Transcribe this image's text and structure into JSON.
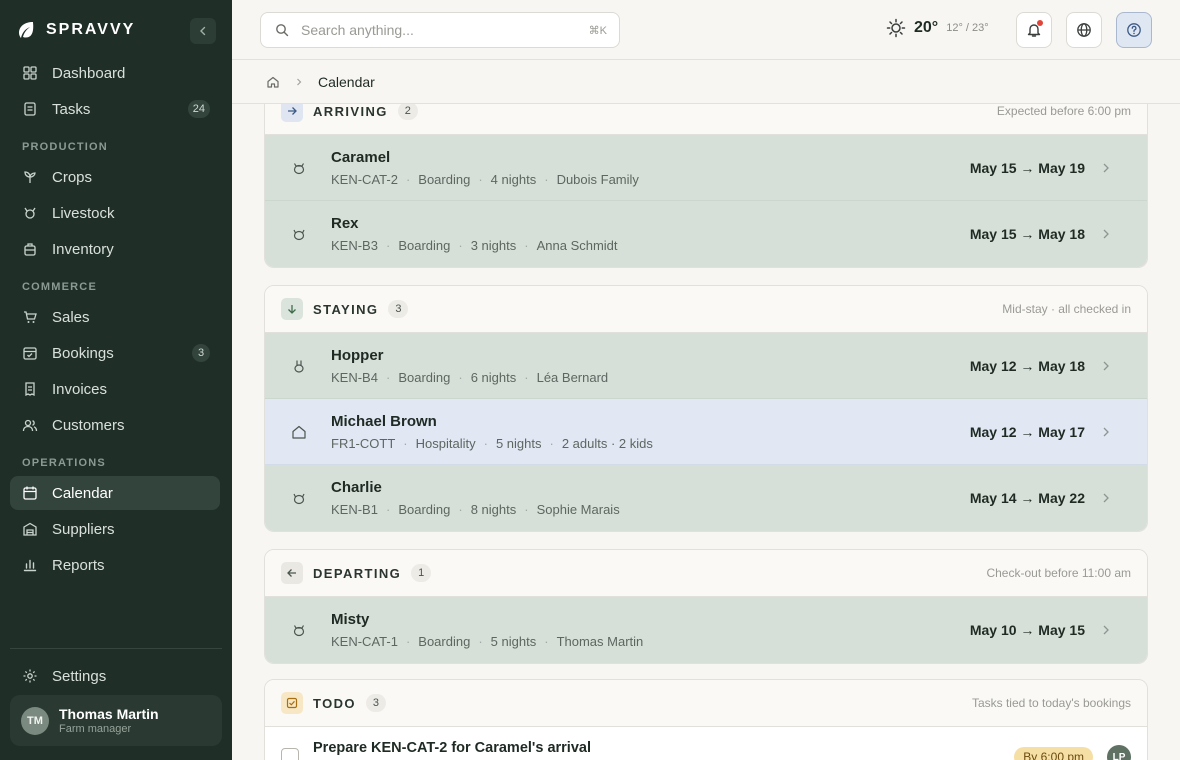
{
  "brand": {
    "name": "SPRAVVY"
  },
  "sidebar": {
    "nav": [
      {
        "label": "Dashboard",
        "icon": "dashboard-icon"
      },
      {
        "label": "Tasks",
        "icon": "tasks-icon",
        "badge": "24"
      }
    ],
    "sections": [
      {
        "title": "PRODUCTION",
        "items": [
          {
            "label": "Crops",
            "icon": "sprout-icon"
          },
          {
            "label": "Livestock",
            "icon": "livestock-icon"
          },
          {
            "label": "Inventory",
            "icon": "inventory-icon"
          }
        ]
      },
      {
        "title": "COMMERCE",
        "items": [
          {
            "label": "Sales",
            "icon": "cart-icon"
          },
          {
            "label": "Bookings",
            "icon": "calendar-check-icon",
            "badge": "3"
          },
          {
            "label": "Invoices",
            "icon": "invoice-icon"
          },
          {
            "label": "Customers",
            "icon": "users-icon"
          }
        ]
      },
      {
        "title": "OPERATIONS",
        "items": [
          {
            "label": "Calendar",
            "icon": "calendar-icon",
            "active": true
          },
          {
            "label": "Suppliers",
            "icon": "warehouse-icon"
          },
          {
            "label": "Reports",
            "icon": "bar-chart-icon"
          }
        ]
      }
    ],
    "settings_label": "Settings",
    "user": {
      "initials": "TM",
      "name": "Thomas Martin",
      "role": "Farm manager"
    }
  },
  "topbar": {
    "search_placeholder": "Search anything...",
    "search_shortcut": "⌘K",
    "weather": {
      "temp": "20°",
      "low": "12°",
      "sep": "/",
      "high": "23°"
    }
  },
  "breadcrumb": {
    "current": "Calendar"
  },
  "groups": {
    "arriving": {
      "title": "ARRIVING",
      "count": "2",
      "note": "Expected before 6:00 pm",
      "rows": [
        {
          "name": "Caramel",
          "unit": "KEN-CAT-2",
          "type": "Boarding",
          "nights": "4 nights",
          "guest": "Dubois Family",
          "dates": "May 15 → May 19"
        },
        {
          "name": "Rex",
          "unit": "KEN-B3",
          "type": "Boarding",
          "nights": "3 nights",
          "guest": "Anna Schmidt",
          "dates": "May 15 → May 18"
        }
      ]
    },
    "staying": {
      "title": "STAYING",
      "count": "3",
      "note": "Mid-stay · all checked in",
      "rows": [
        {
          "name": "Hopper",
          "unit": "KEN-B4",
          "type": "Boarding",
          "nights": "6 nights",
          "guest": "Léa Bernard",
          "dates": "May 12 → May 18"
        },
        {
          "name": "Michael Brown",
          "unit": "FR1-COTT",
          "type": "Hospitality",
          "nights": "5 nights",
          "guest": "2 adults · 2 kids",
          "dates": "May 12 → May 17"
        },
        {
          "name": "Charlie",
          "unit": "KEN-B1",
          "type": "Boarding",
          "nights": "8 nights",
          "guest": "Sophie Marais",
          "dates": "May 14 → May 22"
        }
      ]
    },
    "departing": {
      "title": "DEPARTING",
      "count": "1",
      "note": "Check-out before 11:00 am",
      "rows": [
        {
          "name": "Misty",
          "unit": "KEN-CAT-1",
          "type": "Boarding",
          "nights": "5 nights",
          "guest": "Thomas Martin",
          "dates": "May 10 → May 15"
        }
      ]
    },
    "todo": {
      "title": "TODO",
      "count": "3",
      "note": "Tasks tied to today's bookings",
      "items": [
        {
          "title": "Prepare KEN-CAT-2 for Caramel's arrival",
          "due": "By 6:00 pm",
          "assignee": "LP"
        }
      ]
    }
  },
  "meta_sep": "·"
}
